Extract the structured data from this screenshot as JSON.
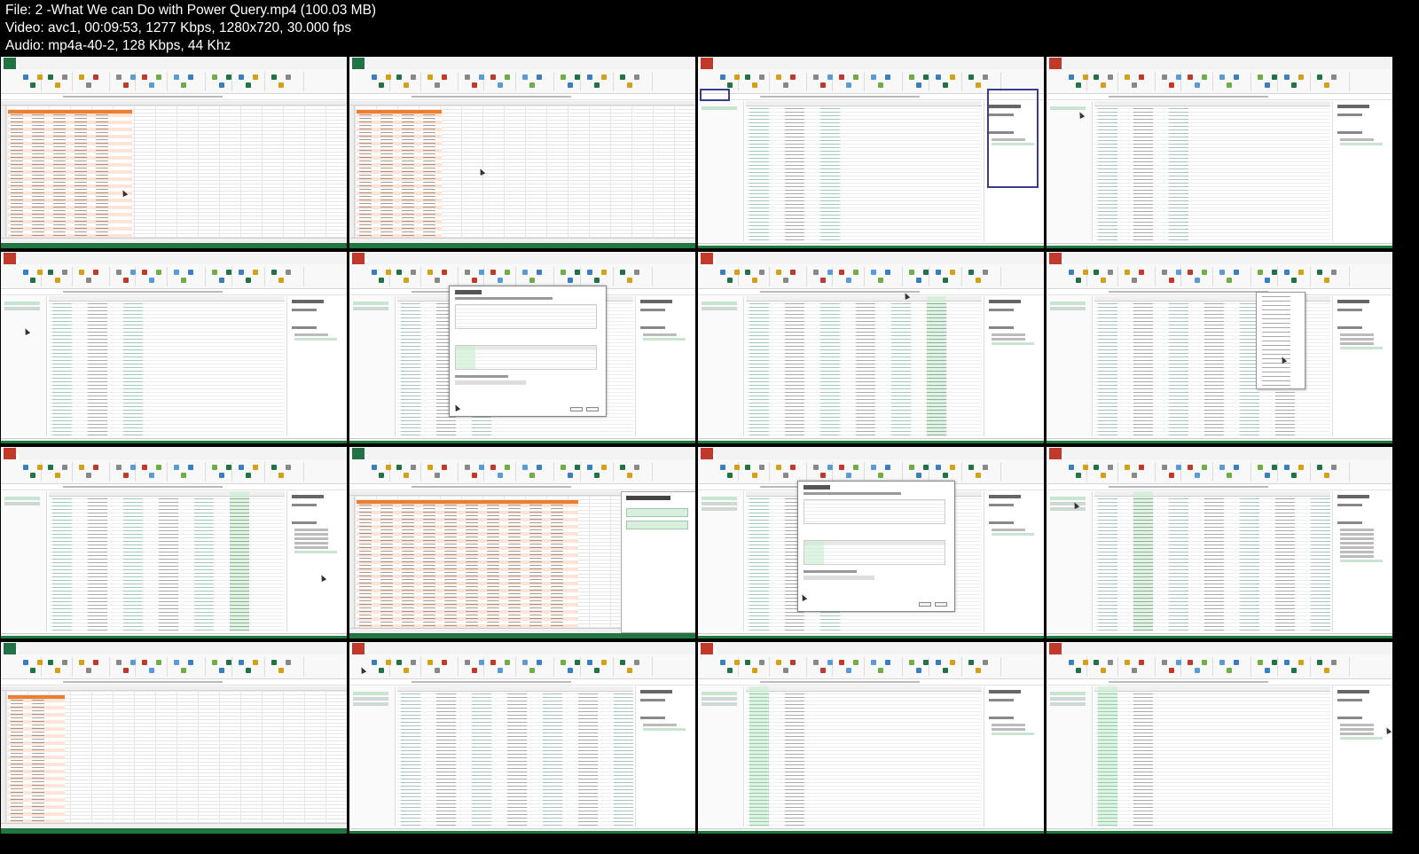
{
  "header": {
    "file": "File: 2 -What We can Do with Power Query.mp4 (100.03 MB)",
    "video": "Video: avc1, 00:09:53, 1277 Kbps, 1280x720, 30.000 fps",
    "audio": "Audio: mp4a-40-2, 128 Kbps, 44 Khz"
  },
  "thumbnails": [
    {
      "view": "excel-sheet"
    },
    {
      "view": "excel-sheet"
    },
    {
      "view": "power-query-editor",
      "highlight": "query-settings"
    },
    {
      "view": "power-query-editor"
    },
    {
      "view": "power-query-editor"
    },
    {
      "view": "power-query-editor",
      "overlay": "merge-dialog"
    },
    {
      "view": "power-query-editor"
    },
    {
      "view": "power-query-editor",
      "overlay": "context-menu"
    },
    {
      "view": "power-query-editor"
    },
    {
      "view": "excel-sheet",
      "overlay": "queries-connections-pane"
    },
    {
      "view": "power-query-editor",
      "overlay": "merge-dialog"
    },
    {
      "view": "power-query-editor"
    },
    {
      "view": "excel-sheet"
    },
    {
      "view": "power-query-editor"
    },
    {
      "view": "power-query-editor"
    },
    {
      "view": "power-query-editor"
    }
  ],
  "colors": {
    "excel_green": "#217346",
    "pq_red": "#c0392b",
    "table_header_orange": "#ed7d31",
    "table_band": "#fce4d6",
    "selection_green": "#c7e5d0",
    "highlight_box": "#3b3b8f"
  }
}
